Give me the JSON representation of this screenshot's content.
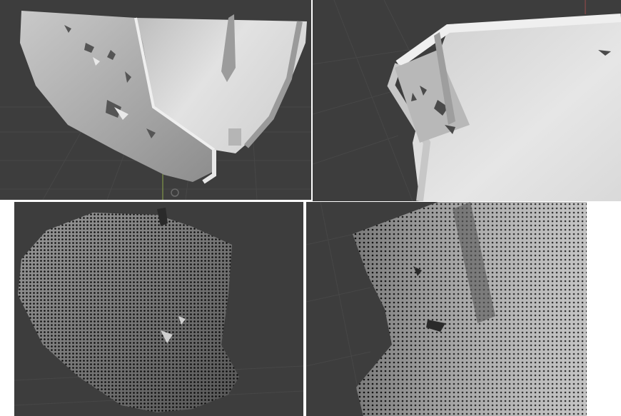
{
  "panels": [
    {
      "id": "top-left",
      "content": "mesh-render"
    },
    {
      "id": "top-right",
      "content": "mesh-render"
    },
    {
      "id": "bottom-left",
      "content": "point-cloud"
    },
    {
      "id": "bottom-right",
      "content": "point-cloud"
    }
  ],
  "colors": {
    "viewport_background": "#3d3d3d",
    "grid_line": "#4a4a4a",
    "mesh_light": "#d6d6d6",
    "mesh_mid": "#a9a9a9",
    "mesh_shadow": "#7c7c7c",
    "point_dark": "#111111",
    "frame_border": "#ffffff"
  }
}
